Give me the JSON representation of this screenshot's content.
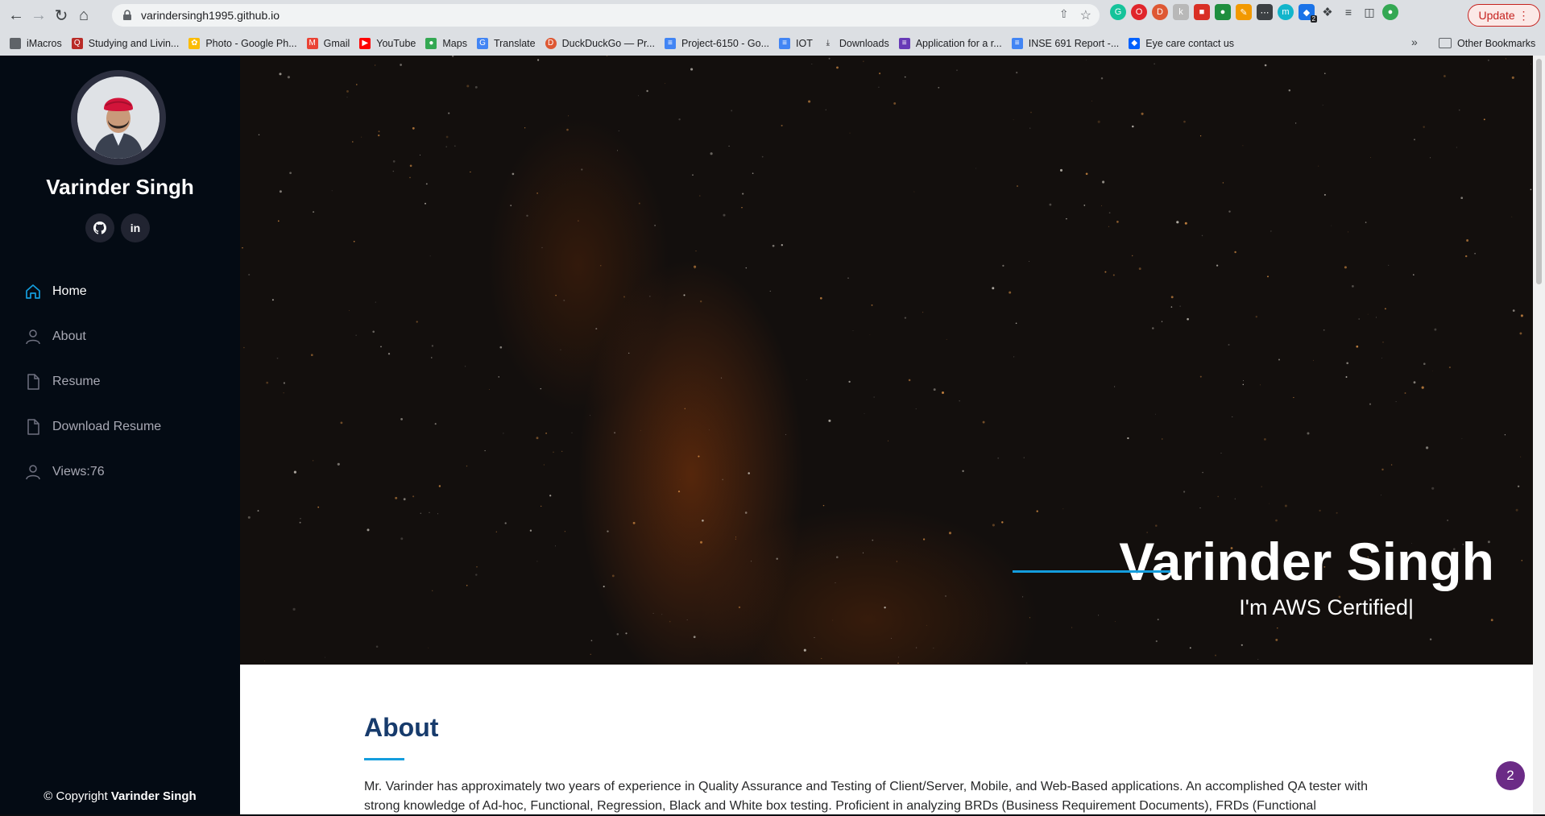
{
  "browser": {
    "url": "varindersingh1995.github.io",
    "update_label": "Update",
    "bookmarks": [
      "iMacros",
      "Studying and Livin...",
      "Photo - Google Ph...",
      "Gmail",
      "YouTube",
      "Maps",
      "Translate",
      "DuckDuckGo — Pr...",
      "Project-6150 - Go...",
      "IOT",
      "Downloads",
      "Application for a r...",
      "INSE 691 Report -...",
      "Eye care contact us"
    ],
    "other_bookmarks": "Other Bookmarks",
    "extension_badge": "2"
  },
  "sidebar": {
    "name": "Varinder Singh",
    "social": [
      "github-icon",
      "linkedin-icon"
    ],
    "nav": [
      {
        "label": "Home",
        "icon": "home-icon",
        "active": true
      },
      {
        "label": "About",
        "icon": "person-icon"
      },
      {
        "label": "Resume",
        "icon": "file-icon"
      },
      {
        "label": "Download Resume",
        "icon": "file-icon"
      },
      {
        "label": "Views:76",
        "icon": "person-icon"
      }
    ],
    "copyright_prefix": "© Copyright",
    "copyright_name": "Varinder Singh"
  },
  "hero": {
    "title": "Varinder Singh",
    "subtitle": "I'm AWS Certified|"
  },
  "about": {
    "title": "About",
    "text": "Mr. Varinder has approximately two years of experience in Quality Assurance and Testing of Client/Server, Mobile, and Web-Based applications. An accomplished QA tester with strong knowledge of Ad-hoc, Functional, Regression, Black and White box testing. Proficient in analyzing BRDs (Business Requirement Documents), FRDs (Functional"
  },
  "notification_badge": "2",
  "colors": {
    "accent": "#149ddd",
    "sidebar": "#040b14",
    "heading": "#173b6c"
  }
}
